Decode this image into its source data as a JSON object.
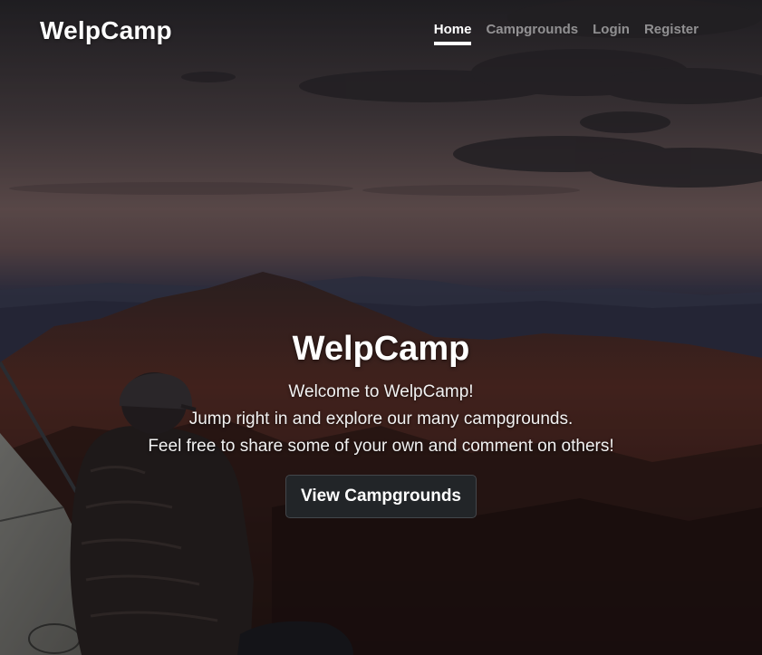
{
  "nav": {
    "brand": "WelpCamp",
    "links": [
      {
        "label": "Home",
        "active": true
      },
      {
        "label": "Campgrounds",
        "active": false
      },
      {
        "label": "Login",
        "active": false
      },
      {
        "label": "Register",
        "active": false
      }
    ]
  },
  "hero": {
    "title": "WelpCamp",
    "lines": [
      "Welcome to WelpCamp!",
      "Jump right in and explore our many campgrounds.",
      "Feel free to share some of your own and comment on others!"
    ],
    "button_label": "View Campgrounds"
  }
}
